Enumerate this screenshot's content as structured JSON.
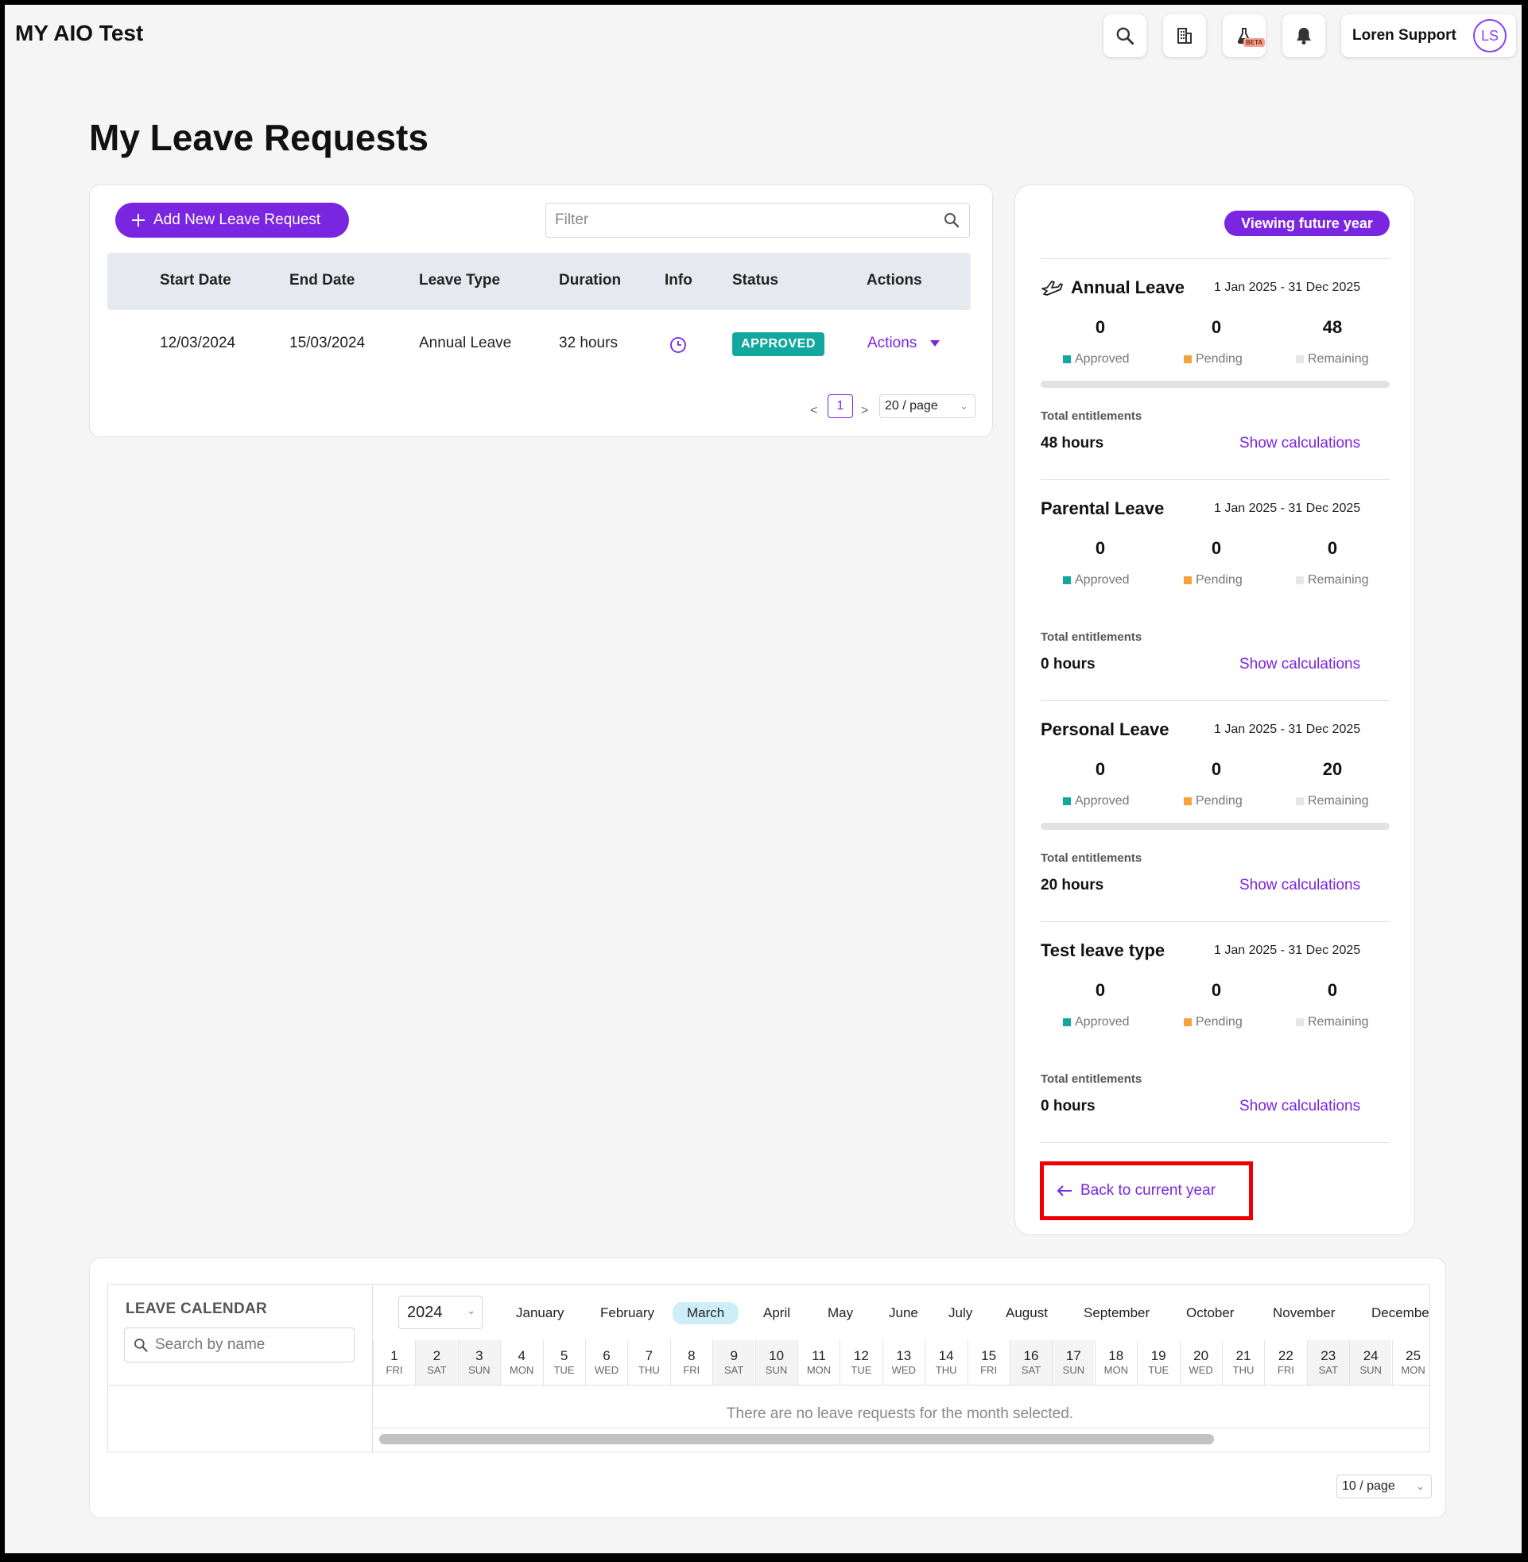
{
  "header": {
    "app_title": "MY AIO Test",
    "beta_label": "BETA",
    "user_name": "Loren Support",
    "user_initials": "LS"
  },
  "page": {
    "title": "My Leave Requests"
  },
  "requests": {
    "add_button": "Add New Leave Request",
    "filter_placeholder": "Filter",
    "columns": [
      "Start Date",
      "End Date",
      "Leave Type",
      "Duration",
      "Info",
      "Status",
      "Actions"
    ],
    "rows": [
      {
        "start": "12/03/2024",
        "end": "15/03/2024",
        "type": "Annual Leave",
        "duration": "32 hours",
        "status": "APPROVED",
        "actions": "Actions"
      }
    ],
    "pagination": {
      "prev": "<",
      "page": "1",
      "next": ">",
      "per_page": "20 / page"
    }
  },
  "sidebar": {
    "badge": "Viewing future year",
    "leave_types": [
      {
        "name": "Annual Leave",
        "range": "1 Jan 2025 - 31 Dec 2025",
        "approved": "0",
        "pending": "0",
        "remaining": "48",
        "entitlement_label": "Total entitlements",
        "entitlement": "48 hours",
        "show_calc": "Show calculations"
      },
      {
        "name": "Parental Leave",
        "range": "1 Jan 2025 - 31 Dec 2025",
        "approved": "0",
        "pending": "0",
        "remaining": "0",
        "entitlement_label": "Total entitlements",
        "entitlement": "0 hours",
        "show_calc": "Show calculations"
      },
      {
        "name": "Personal Leave",
        "range": "1 Jan 2025 - 31 Dec 2025",
        "approved": "0",
        "pending": "0",
        "remaining": "20",
        "entitlement_label": "Total entitlements",
        "entitlement": "20 hours",
        "show_calc": "Show calculations"
      },
      {
        "name": "Test leave type",
        "range": "1 Jan 2025 - 31 Dec 2025",
        "approved": "0",
        "pending": "0",
        "remaining": "0",
        "entitlement_label": "Total entitlements",
        "entitlement": "0 hours",
        "show_calc": "Show calculations"
      }
    ],
    "labels": {
      "approved": "Approved",
      "pending": "Pending",
      "remaining": "Remaining"
    },
    "back_link": "Back to current year"
  },
  "calendar": {
    "title": "LEAVE CALENDAR",
    "search_placeholder": "Search by name",
    "year": "2024",
    "months": [
      "January",
      "February",
      "March",
      "April",
      "May",
      "June",
      "July",
      "August",
      "September",
      "October",
      "November",
      "Decembe"
    ],
    "selected_month": "March",
    "days": [
      {
        "d": "1",
        "w": "FRI"
      },
      {
        "d": "2",
        "w": "SAT"
      },
      {
        "d": "3",
        "w": "SUN"
      },
      {
        "d": "4",
        "w": "MON"
      },
      {
        "d": "5",
        "w": "TUE"
      },
      {
        "d": "6",
        "w": "WED"
      },
      {
        "d": "7",
        "w": "THU"
      },
      {
        "d": "8",
        "w": "FRI"
      },
      {
        "d": "9",
        "w": "SAT"
      },
      {
        "d": "10",
        "w": "SUN"
      },
      {
        "d": "11",
        "w": "MON"
      },
      {
        "d": "12",
        "w": "TUE"
      },
      {
        "d": "13",
        "w": "WED"
      },
      {
        "d": "14",
        "w": "THU"
      },
      {
        "d": "15",
        "w": "FRI"
      },
      {
        "d": "16",
        "w": "SAT"
      },
      {
        "d": "17",
        "w": "SUN"
      },
      {
        "d": "18",
        "w": "MON"
      },
      {
        "d": "19",
        "w": "TUE"
      },
      {
        "d": "20",
        "w": "WED"
      },
      {
        "d": "21",
        "w": "THU"
      },
      {
        "d": "22",
        "w": "FRI"
      },
      {
        "d": "23",
        "w": "SAT"
      },
      {
        "d": "24",
        "w": "SUN"
      },
      {
        "d": "25",
        "w": "MON"
      }
    ],
    "empty_message": "There are no leave requests for the month selected.",
    "per_page": "10 / page"
  },
  "colors": {
    "accent": "#7a25e0",
    "approved": "#13a89e",
    "pending": "#f7a33c",
    "remaining": "#e6e6e6",
    "highlight": "#ee0000"
  }
}
